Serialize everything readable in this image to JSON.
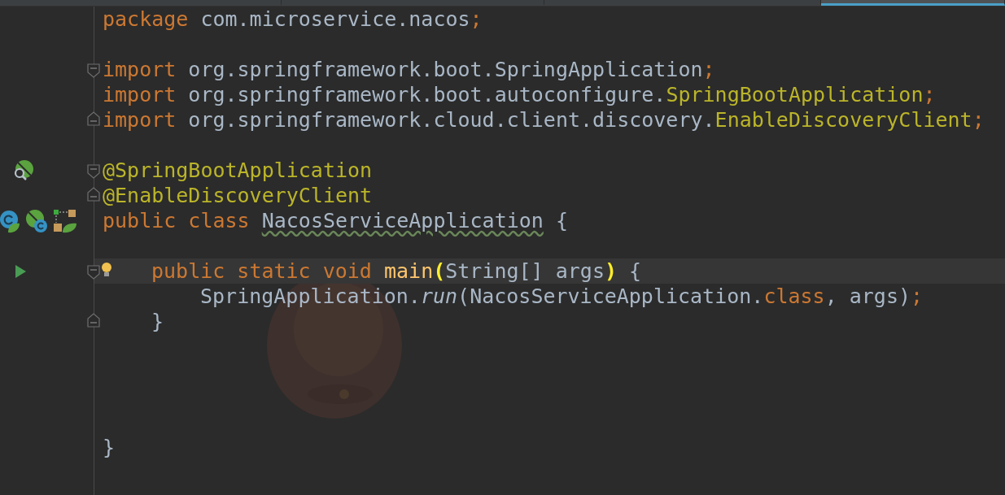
{
  "tabs": [
    {
      "selected": false
    },
    {
      "selected": false
    },
    {
      "selected": false
    },
    {
      "selected": true
    }
  ],
  "editor": {
    "lines": [
      {
        "kind": "code",
        "tokens": [
          {
            "text": "package",
            "kind": "keyword"
          },
          {
            "text": " com.microservice.nacos",
            "kind": "plain"
          },
          {
            "text": ";",
            "kind": "semicolon"
          }
        ]
      },
      {
        "kind": "blank"
      },
      {
        "kind": "code",
        "fold": {
          "kind": "start"
        },
        "tokens": [
          {
            "text": "import",
            "kind": "keyword"
          },
          {
            "text": " org.springframework.boot.SpringApplication",
            "kind": "plain"
          },
          {
            "text": ";",
            "kind": "semicolon"
          }
        ]
      },
      {
        "kind": "code",
        "tokens": [
          {
            "text": "import",
            "kind": "keyword"
          },
          {
            "text": " org.springframework.boot.autoconfigure.",
            "kind": "plain"
          },
          {
            "text": "SpringBootApplication",
            "kind": "annotation"
          },
          {
            "text": ";",
            "kind": "semicolon"
          }
        ]
      },
      {
        "kind": "code",
        "fold": {
          "kind": "end"
        },
        "tokens": [
          {
            "text": "import",
            "kind": "keyword"
          },
          {
            "text": " org.springframework.cloud.client.discovery.",
            "kind": "plain"
          },
          {
            "text": "EnableDiscoveryClient",
            "kind": "annotation"
          },
          {
            "text": ";",
            "kind": "semicolon"
          }
        ]
      },
      {
        "kind": "blank"
      },
      {
        "kind": "code",
        "fold": {
          "kind": "start"
        },
        "gutter_icons": [
          {
            "kind": "leaf-search"
          }
        ],
        "tokens": [
          {
            "text": "@SpringBootApplication",
            "kind": "annotation"
          }
        ]
      },
      {
        "kind": "code",
        "fold": {
          "kind": "end"
        },
        "tokens": [
          {
            "text": "@EnableDiscoveryClient",
            "kind": "annotation"
          }
        ]
      },
      {
        "kind": "code",
        "gutter_icons": [
          {
            "kind": "class-leaf"
          },
          {
            "kind": "leaf-class"
          },
          {
            "kind": "diagram"
          }
        ],
        "tokens": [
          {
            "text": "public class",
            "kind": "keyword",
            "space_after": true
          },
          {
            "text": "NacosServiceApplication",
            "kind": "typo"
          },
          {
            "text": " {",
            "kind": "plain"
          }
        ]
      },
      {
        "kind": "blank"
      },
      {
        "kind": "code",
        "current": true,
        "indent": {
          "kind": "member"
        },
        "fold": {
          "kind": "start"
        },
        "bulb": true,
        "gutter_icons": [
          {
            "kind": "run"
          }
        ],
        "tokens": [
          {
            "text": "public static void",
            "kind": "keyword",
            "space_after": true
          },
          {
            "text": "main",
            "kind": "method"
          },
          {
            "text": "(",
            "kind": "brace_match"
          },
          {
            "text": "String[] args",
            "kind": "plain"
          },
          {
            "text": ")",
            "kind": "brace_match"
          },
          {
            "text": " {",
            "kind": "plain"
          }
        ]
      },
      {
        "kind": "code",
        "indent": {
          "kind": "statement"
        },
        "tokens": [
          {
            "text": "SpringApplication.",
            "kind": "plain"
          },
          {
            "text": "run",
            "kind": "static_call"
          },
          {
            "text": "(NacosServiceApplication.",
            "kind": "plain"
          },
          {
            "text": "class",
            "kind": "keyword"
          },
          {
            "text": ", args)",
            "kind": "plain"
          },
          {
            "text": ";",
            "kind": "semicolon"
          }
        ]
      },
      {
        "kind": "code",
        "indent": {
          "kind": "member"
        },
        "fold": {
          "kind": "end"
        },
        "tokens": [
          {
            "text": "}",
            "kind": "plain"
          }
        ]
      },
      {
        "kind": "blank"
      },
      {
        "kind": "blank"
      },
      {
        "kind": "blank"
      },
      {
        "kind": "blank"
      },
      {
        "kind": "code",
        "tokens": [
          {
            "text": "}",
            "kind": "plain"
          }
        ]
      }
    ]
  }
}
